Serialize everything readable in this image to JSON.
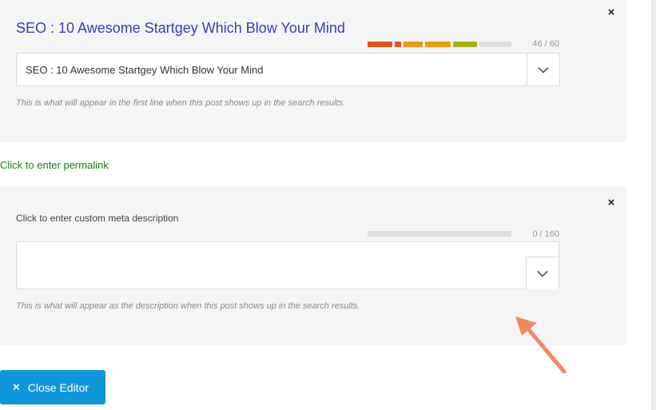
{
  "title_panel": {
    "seo_title": "SEO : 10 Awesome Startgey Which Blow Your Mind",
    "counter": "46 / 60",
    "input_value": "SEO : 10 Awesome Startgey Which Blow Your Mind",
    "hint": "This is what will appear in the first line when this post shows up in the search results.",
    "close_glyph": "×",
    "progress": 0.77,
    "meter_colors": [
      "#e2571e",
      "#e2571e",
      "#e59a1c",
      "#e5a112",
      "#a4b51c",
      "#e0e0e0"
    ]
  },
  "permalink": {
    "label": "Click to enter permalink"
  },
  "description_panel": {
    "label": "Click to enter custom meta description",
    "counter": "0 / 160",
    "input_value": "",
    "hint": "This is what will appear as the description when this post shows up in the search results.",
    "close_glyph": "×",
    "progress": 0,
    "meter_color": "#dedede"
  },
  "footer": {
    "close_editor_label": "Close Editor",
    "close_editor_icon": "×",
    "button_color": "#0f97d9"
  },
  "annotation": {
    "arrow_color": "#f08a64"
  }
}
